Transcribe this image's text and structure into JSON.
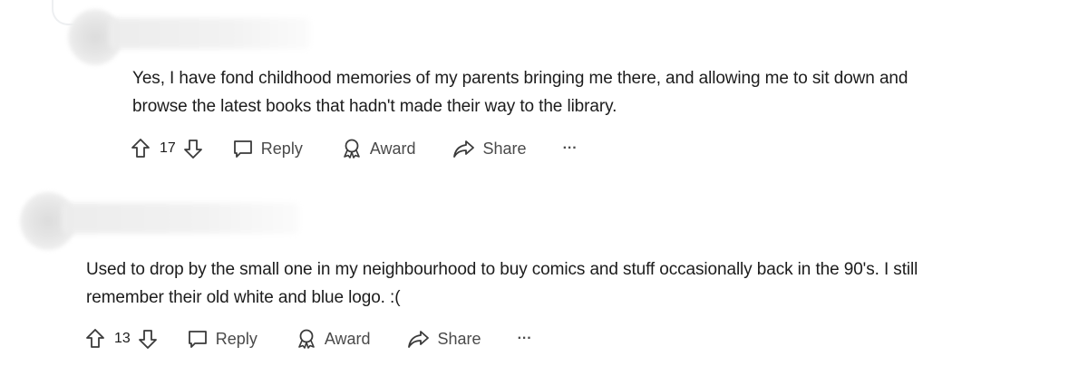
{
  "comments": [
    {
      "text_lines": [
        "Yes, I have fond childhood memories of my parents bringing me there, and allowing me to sit down and",
        "browse the latest books that hadn't made their way to the library."
      ],
      "votes": "17",
      "reply_label": "Reply",
      "award_label": "Award",
      "share_label": "Share",
      "more_label": "···"
    },
    {
      "text_lines": [
        "Used to drop by the small one in my neighbourhood to buy comics and stuff occasionally back in the 90's. I still",
        "remember their old white and blue logo. :("
      ],
      "votes": "13",
      "reply_label": "Reply",
      "award_label": "Award",
      "share_label": "Share",
      "more_label": "···"
    }
  ],
  "icons": {
    "upvote": "arrow-up-icon",
    "downvote": "arrow-down-icon",
    "reply": "speech-bubble-icon",
    "award": "award-ribbon-icon",
    "share": "share-arrow-icon",
    "more": "ellipsis-icon"
  }
}
